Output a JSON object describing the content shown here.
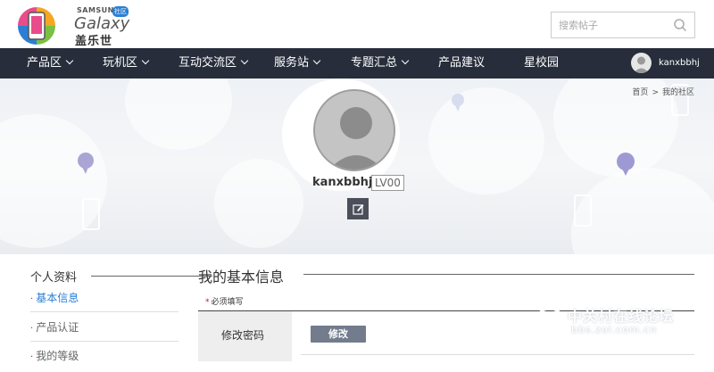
{
  "logo": {
    "brand": "SAMSUNG",
    "product": "Galaxy",
    "badge": "社区",
    "chinese": "盖乐世"
  },
  "search": {
    "placeholder": "搜索帖子"
  },
  "nav": {
    "items": [
      {
        "label": "产品区",
        "has_dropdown": true
      },
      {
        "label": "玩机区",
        "has_dropdown": true
      },
      {
        "label": "互动交流区",
        "has_dropdown": true
      },
      {
        "label": "服务站",
        "has_dropdown": true
      },
      {
        "label": "专题汇总",
        "has_dropdown": true
      },
      {
        "label": "产品建议",
        "has_dropdown": false
      },
      {
        "label": "星校园",
        "has_dropdown": false
      }
    ],
    "username": "kanxbbhj"
  },
  "breadcrumb": {
    "home": "首页",
    "separator": ">",
    "current": "我的社区"
  },
  "profile": {
    "name": "kanxbbhj",
    "level": "LV00"
  },
  "sidebar": {
    "title": "个人资料",
    "items": [
      {
        "label": "基本信息",
        "active": true
      },
      {
        "label": "产品认证",
        "active": false
      },
      {
        "label": "我的等级",
        "active": false
      }
    ]
  },
  "main": {
    "title": "我的基本信息",
    "required_star": "*",
    "required_note": "必须填写",
    "rows": [
      {
        "label": "修改密码",
        "button": "修改"
      }
    ]
  },
  "watermark": {
    "text": "中关村在线论坛",
    "url": "bbs.zol.com.cn"
  },
  "colors": {
    "nav_bg": "#272d3b",
    "active_link": "#2a7fd4",
    "required_star": "#cc1133",
    "modify_button": "#737c8c"
  }
}
